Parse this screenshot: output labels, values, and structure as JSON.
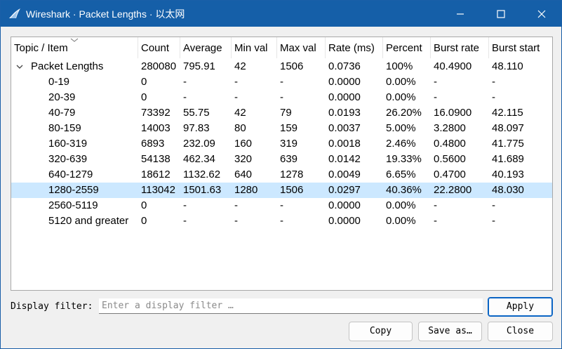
{
  "window": {
    "title": "Wireshark · Packet Lengths · 以太网",
    "minimize_icon": "minimize-icon",
    "maximize_icon": "maximize-icon",
    "close_icon": "close-icon"
  },
  "table": {
    "columns": [
      "Topic / Item",
      "Count",
      "Average",
      "Min val",
      "Max val",
      "Rate (ms)",
      "Percent",
      "Burst rate",
      "Burst start"
    ],
    "rows": [
      {
        "cells": [
          "Packet Lengths",
          "280080",
          "795.91",
          "42",
          "1506",
          "0.0736",
          "100%",
          "40.4900",
          "48.110"
        ],
        "level": 0,
        "expanded": true,
        "selected": false
      },
      {
        "cells": [
          "0-19",
          "0",
          "-",
          "-",
          "-",
          "0.0000",
          "0.00%",
          "-",
          "-"
        ],
        "level": 1,
        "selected": false
      },
      {
        "cells": [
          "20-39",
          "0",
          "-",
          "-",
          "-",
          "0.0000",
          "0.00%",
          "-",
          "-"
        ],
        "level": 1,
        "selected": false
      },
      {
        "cells": [
          "40-79",
          "73392",
          "55.75",
          "42",
          "79",
          "0.0193",
          "26.20%",
          "16.0900",
          "42.115"
        ],
        "level": 1,
        "selected": false
      },
      {
        "cells": [
          "80-159",
          "14003",
          "97.83",
          "80",
          "159",
          "0.0037",
          "5.00%",
          "3.2800",
          "48.097"
        ],
        "level": 1,
        "selected": false
      },
      {
        "cells": [
          "160-319",
          "6893",
          "232.09",
          "160",
          "319",
          "0.0018",
          "2.46%",
          "0.4800",
          "41.775"
        ],
        "level": 1,
        "selected": false
      },
      {
        "cells": [
          "320-639",
          "54138",
          "462.34",
          "320",
          "639",
          "0.0142",
          "19.33%",
          "0.5600",
          "41.689"
        ],
        "level": 1,
        "selected": false
      },
      {
        "cells": [
          "640-1279",
          "18612",
          "1132.62",
          "640",
          "1278",
          "0.0049",
          "6.65%",
          "0.4700",
          "40.193"
        ],
        "level": 1,
        "selected": false
      },
      {
        "cells": [
          "1280-2559",
          "113042",
          "1501.63",
          "1280",
          "1506",
          "0.0297",
          "40.36%",
          "22.2800",
          "48.030"
        ],
        "level": 1,
        "selected": true
      },
      {
        "cells": [
          "2560-5119",
          "0",
          "-",
          "-",
          "-",
          "0.0000",
          "0.00%",
          "-",
          "-"
        ],
        "level": 1,
        "selected": false
      },
      {
        "cells": [
          "5120 and greater",
          "0",
          "-",
          "-",
          "-",
          "0.0000",
          "0.00%",
          "-",
          "-"
        ],
        "level": 1,
        "selected": false
      }
    ]
  },
  "filter": {
    "label": "Display filter:",
    "value": "",
    "placeholder": "Enter a display filter …"
  },
  "buttons": {
    "apply": "Apply",
    "copy": "Copy",
    "save_as": "Save as…",
    "close": "Close"
  },
  "colors": {
    "titlebar": "#155fa8",
    "selected_row": "#cce8ff",
    "default_button_border": "#0a64c4"
  }
}
